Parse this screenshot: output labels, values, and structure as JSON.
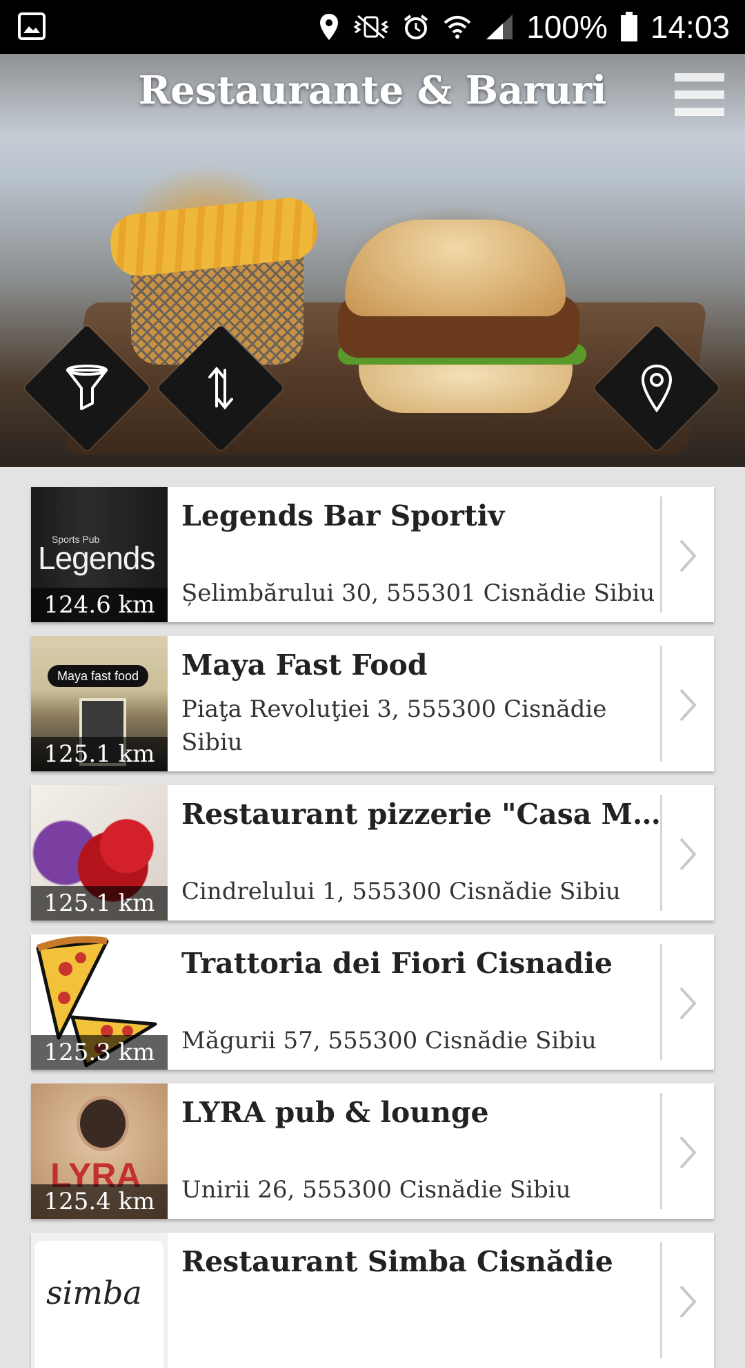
{
  "status_bar": {
    "battery": "100%",
    "time": "14:03",
    "icons": [
      "gallery-icon",
      "location-icon",
      "vibrate-mute-icon",
      "alarm-icon",
      "wifi-icon",
      "signal-icon",
      "battery-icon"
    ]
  },
  "header": {
    "title": "Restaurante & Baruri",
    "menu_icon": "hamburger-menu-icon"
  },
  "actions": {
    "filter_icon": "filter-icon",
    "sort_icon": "sort-icon",
    "map_icon": "map-pin-icon"
  },
  "places": [
    {
      "name": "Legends Bar Sportiv",
      "address": "Șelimbărului 30, 555301 Cisnădie Sibiu",
      "distance": "124.6 km",
      "thumb_text": "Legends",
      "thumb_sub": "Sports Pub"
    },
    {
      "name": "Maya Fast Food",
      "address": "Piaţa Revoluţiei 3, 555300 Cisnădie Sibiu",
      "distance": "125.1 km",
      "thumb_text": "Maya fast food"
    },
    {
      "name": "Restaurant pizzerie \"Casa Magu...",
      "address": "Cindrelului 1, 555300 Cisnădie Sibiu",
      "distance": "125.1 km"
    },
    {
      "name": "Trattoria dei Fiori Cisnadie",
      "address": "Măgurii 57, 555300 Cisnădie Sibiu",
      "distance": "125.3 km"
    },
    {
      "name": "LYRA pub & lounge",
      "address": "Unirii 26, 555300 Cisnădie Sibiu",
      "distance": "125.4 km",
      "thumb_text": "LYRA"
    },
    {
      "name": "Restaurant Simba Cisnădie",
      "address": "",
      "distance": "",
      "thumb_text": "simba"
    }
  ]
}
